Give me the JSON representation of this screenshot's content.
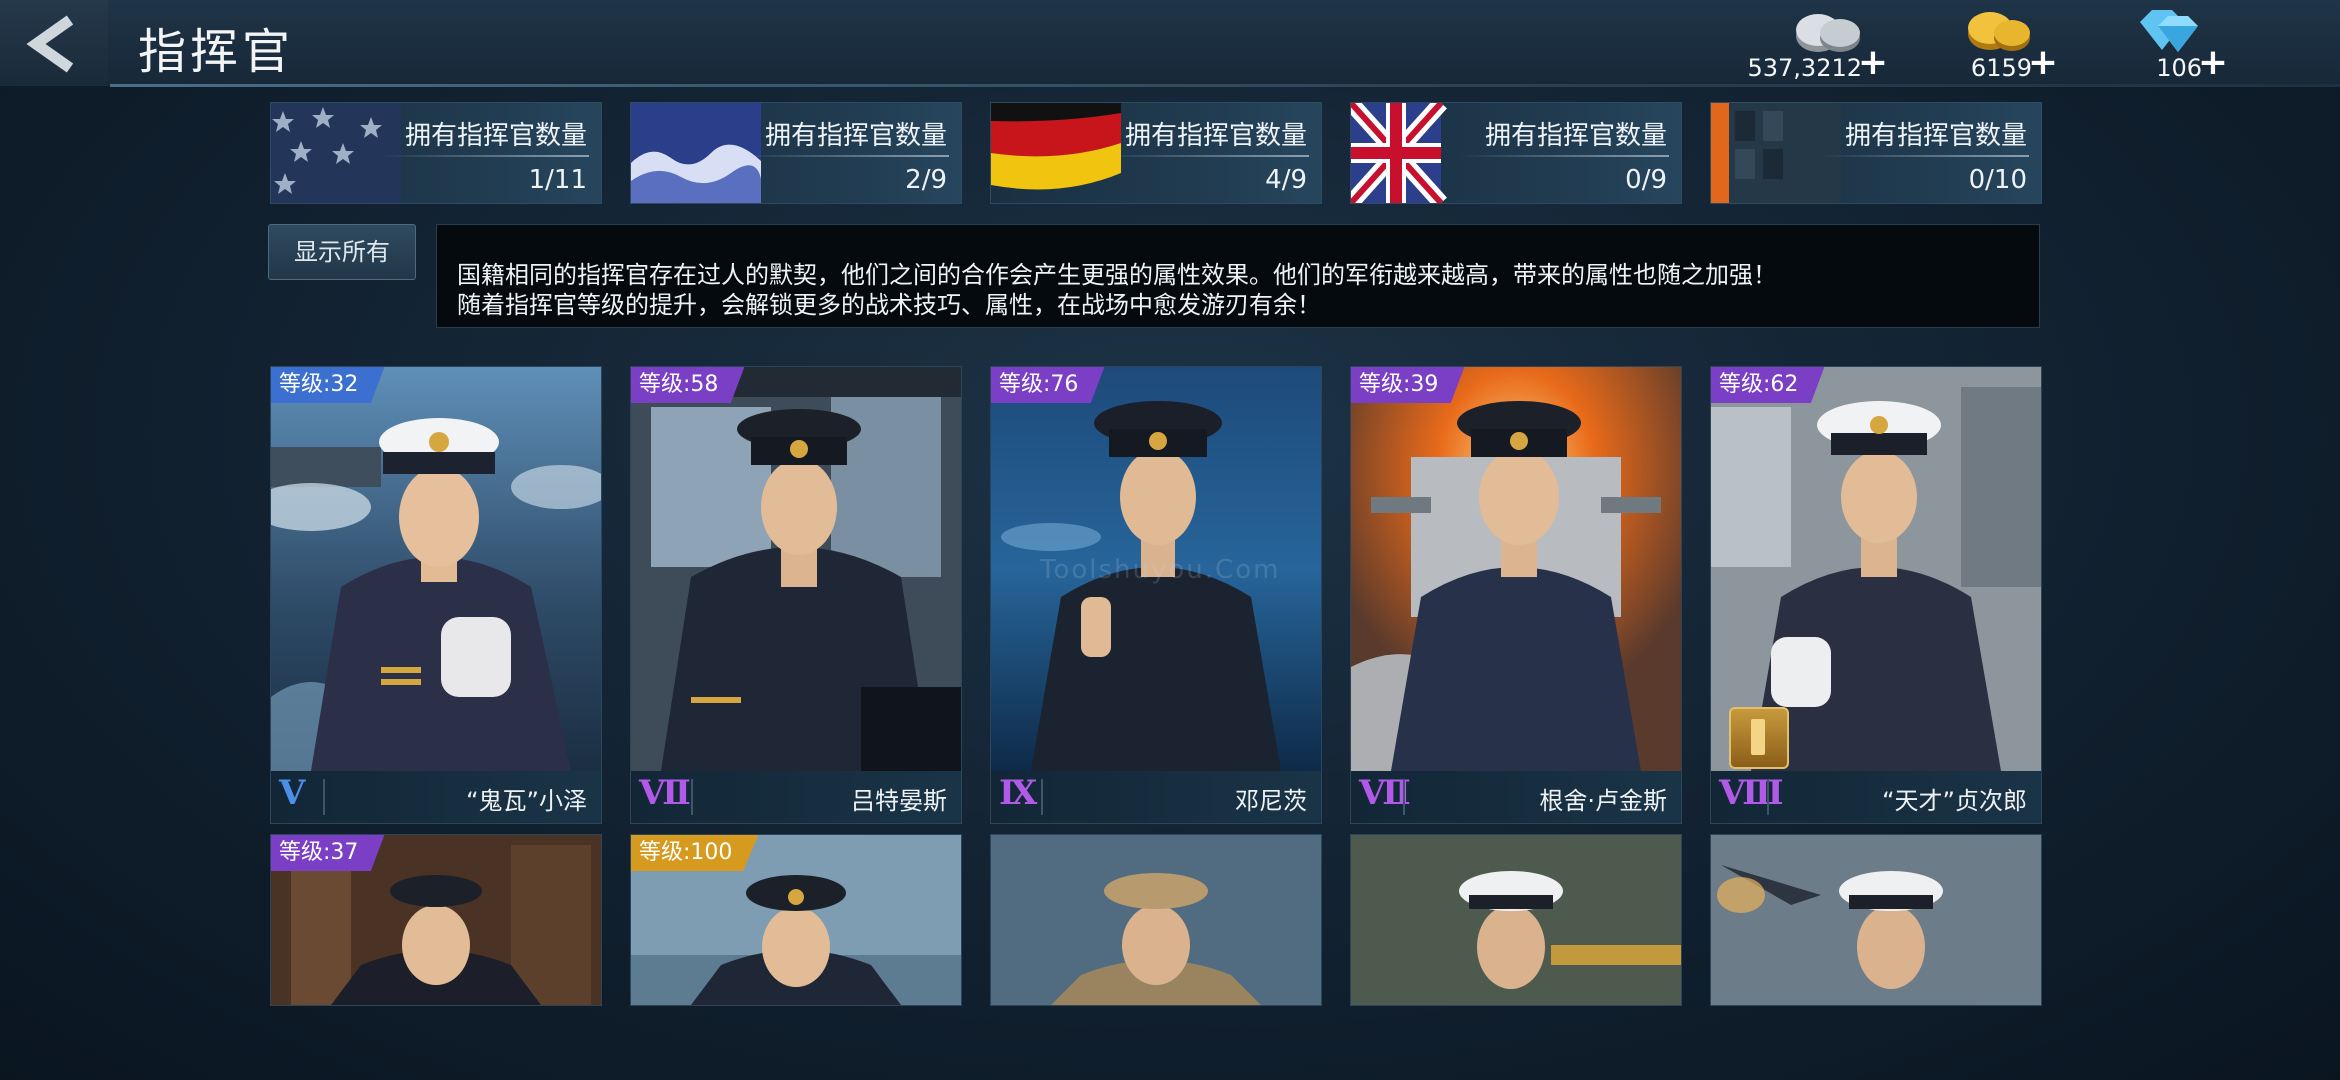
{
  "header": {
    "title": "指挥官",
    "resources": [
      {
        "name": "silver",
        "icon": "silver-coins-icon",
        "value": "537,3212"
      },
      {
        "name": "gold",
        "icon": "gold-coins-icon",
        "value": "6159"
      },
      {
        "name": "diamond",
        "icon": "diamond-icon",
        "value": "106"
      }
    ],
    "plus": "+"
  },
  "nations": [
    {
      "flag": "usa-flag",
      "label": "拥有指挥官数量",
      "count": "1/11"
    },
    {
      "flag": "japan-flag",
      "label": "拥有指挥官数量",
      "count": "2/9"
    },
    {
      "flag": "germany-flag",
      "label": "拥有指挥官数量",
      "count": "4/9"
    },
    {
      "flag": "uk-flag",
      "label": "拥有指挥官数量",
      "count": "0/9"
    },
    {
      "flag": "other-flag",
      "label": "拥有指挥官数量",
      "count": "0/10"
    }
  ],
  "filter": {
    "show_all": "显示所有"
  },
  "info": {
    "line1": "国籍相同的指挥官存在过人的默契，他们之间的合作会产生更强的属性效果。他们的军衔越来越高，带来的属性也随之加强！",
    "line2": "随着指挥官等级的提升，会解锁更多的战术技巧、属性，在战场中愈发游刃有余！"
  },
  "cards_row1": [
    {
      "level": "等级:32",
      "rank": "Ⅴ",
      "name": "“鬼瓦”小泽",
      "level_color": "#3b6fd0",
      "rank_color": "#4d8fe6"
    },
    {
      "level": "等级:58",
      "rank": "Ⅶ",
      "name": "吕特晏斯",
      "level_color": "#7a3fc4",
      "rank_color": "#b15ae8"
    },
    {
      "level": "等级:76",
      "rank": "Ⅸ",
      "name": "邓尼茨",
      "level_color": "#7a3fc4",
      "rank_color": "#b15ae8"
    },
    {
      "level": "等级:39",
      "rank": "Ⅶ",
      "name": "根舍·卢金斯",
      "level_color": "#7a3fc4",
      "rank_color": "#b15ae8"
    },
    {
      "level": "等级:62",
      "rank": "Ⅷ",
      "name": "“天才”贞次郎",
      "level_color": "#7a3fc4",
      "rank_color": "#b15ae8"
    }
  ],
  "cards_row2": [
    {
      "level": "等级:37",
      "level_color": "#7a3fc4"
    },
    {
      "level": "等级:100",
      "level_color": "#d69a1f"
    },
    {
      "level": "",
      "level_color": ""
    },
    {
      "level": "",
      "level_color": ""
    },
    {
      "level": "",
      "level_color": ""
    }
  ],
  "watermark": "Toolshuyou.Com"
}
